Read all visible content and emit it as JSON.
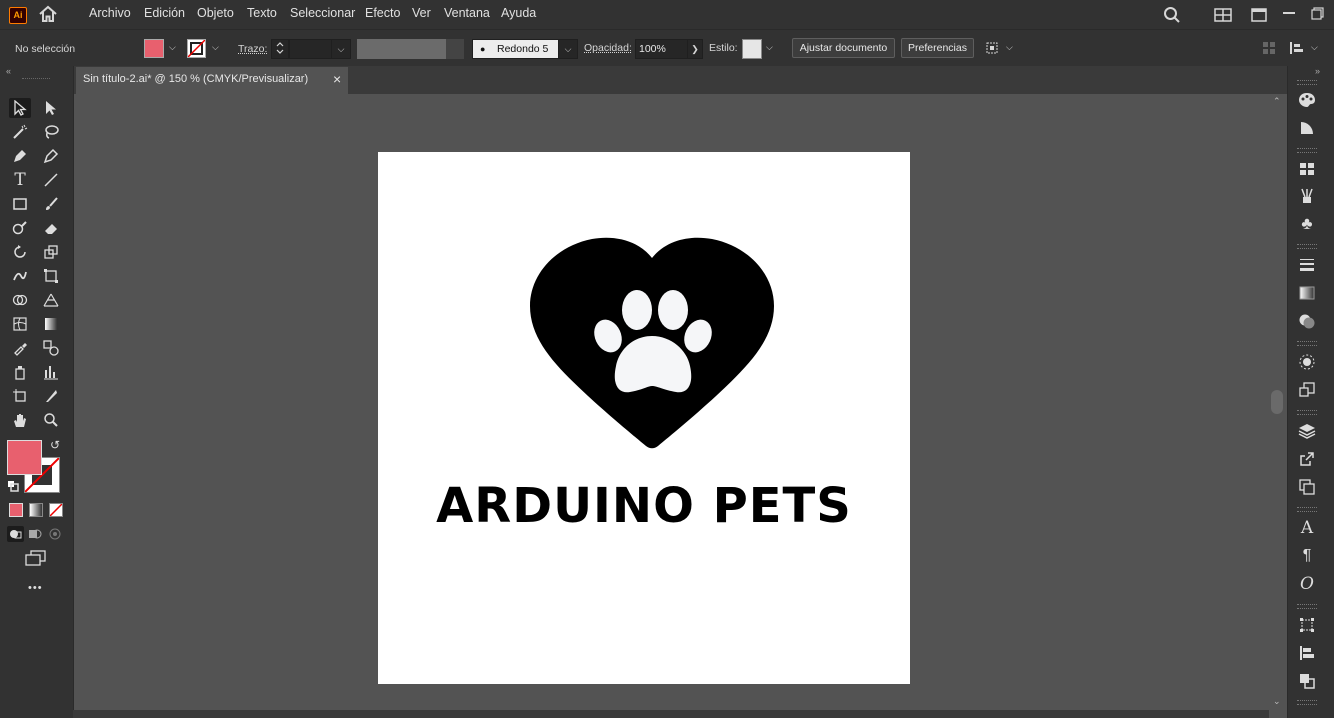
{
  "app": {
    "logo": "Ai",
    "home_icon": "home-icon"
  },
  "menu": [
    "Archivo",
    "Edición",
    "Objeto",
    "Texto",
    "Seleccionar",
    "Efecto",
    "Ver",
    "Ventana",
    "Ayuda"
  ],
  "control": {
    "selection_status": "No selección",
    "fill_color": "#e8606e",
    "stroke_label": "Trazo:",
    "brush_label": "Redondo 5 ...",
    "opacity_label": "Opacidad:",
    "opacity_value": "100%",
    "style_label": "Estilo:",
    "fit_document_button": "Ajustar documento",
    "preferences_button": "Preferencias"
  },
  "document_tab": {
    "title": "Sin título-2.ai* @ 150 % (CMYK/Previsualizar)",
    "close": "×"
  },
  "toolbar": {
    "fill_color": "#e8606e",
    "more": "•••"
  },
  "artboard": {
    "brand_text": "ARDUINO PETS",
    "logo_icon": "heart-paw-icon"
  },
  "colors": {
    "app_bg": "#323232",
    "canvas_bg": "#535353",
    "accent_fill": "#e8606e"
  }
}
